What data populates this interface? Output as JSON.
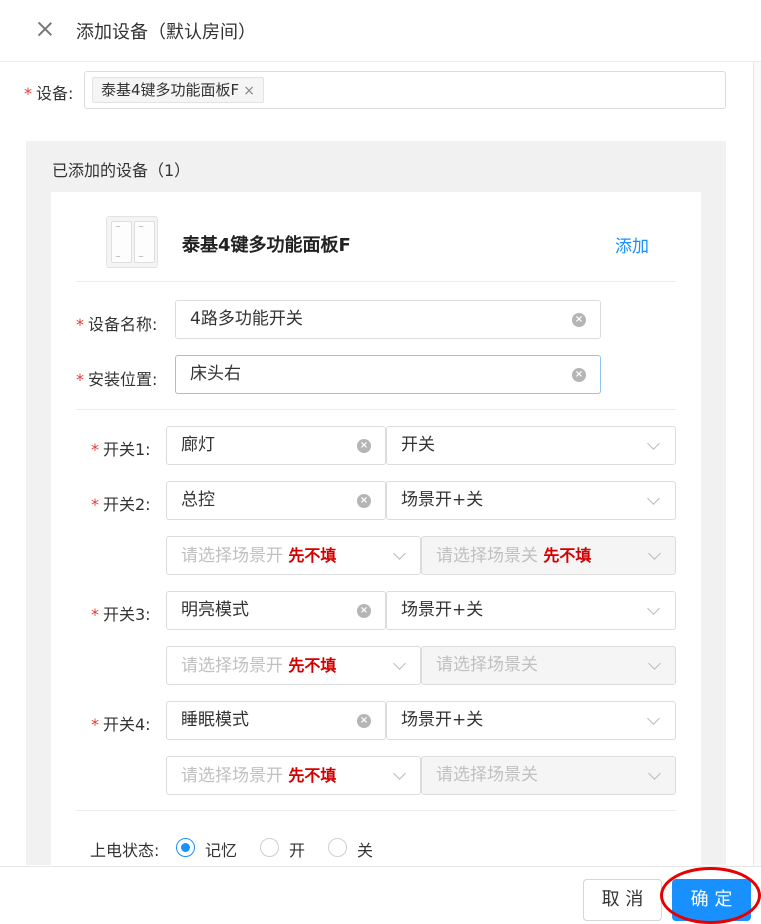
{
  "header": {
    "title": "添加设备（默认房间）"
  },
  "device_field": {
    "label": "设备:",
    "tag": "泰基4键多功能面板F",
    "tag_remove": "×"
  },
  "panel": {
    "title": "已添加的设备（1）"
  },
  "card": {
    "device_name": "泰基4键多功能面板F",
    "add_link": "添加",
    "name_label": "设备名称:",
    "name_value": "4路多功能开关",
    "location_label": "安装位置:",
    "location_value": "床头右"
  },
  "switches": [
    {
      "label": "开关1:",
      "name": "廊灯",
      "type": "开关"
    },
    {
      "label": "开关2:",
      "name": "总控",
      "type": "场景开+关",
      "scene_on_placeholder": "请选择场景开",
      "scene_on_note": "先不填",
      "scene_off_placeholder": "请选择场景关",
      "scene_off_note": "先不填"
    },
    {
      "label": "开关3:",
      "name": "明亮模式",
      "type": "场景开+关",
      "scene_on_placeholder": "请选择场景开",
      "scene_on_note": "先不填",
      "scene_off_placeholder": "请选择场景关"
    },
    {
      "label": "开关4:",
      "name": "睡眠模式",
      "type": "场景开+关",
      "scene_on_placeholder": "请选择场景开",
      "scene_on_note": "先不填",
      "scene_off_placeholder": "请选择场景关"
    }
  ],
  "power_state": {
    "label": "上电状态:",
    "options": [
      "记忆",
      "开",
      "关"
    ],
    "selected": "记忆"
  },
  "footer": {
    "cancel": "取 消",
    "ok": "确 定"
  },
  "colors": {
    "primary": "#1890ff",
    "required": "#e53935",
    "note_red": "#d40000",
    "highlight_ring": "#e60000"
  }
}
